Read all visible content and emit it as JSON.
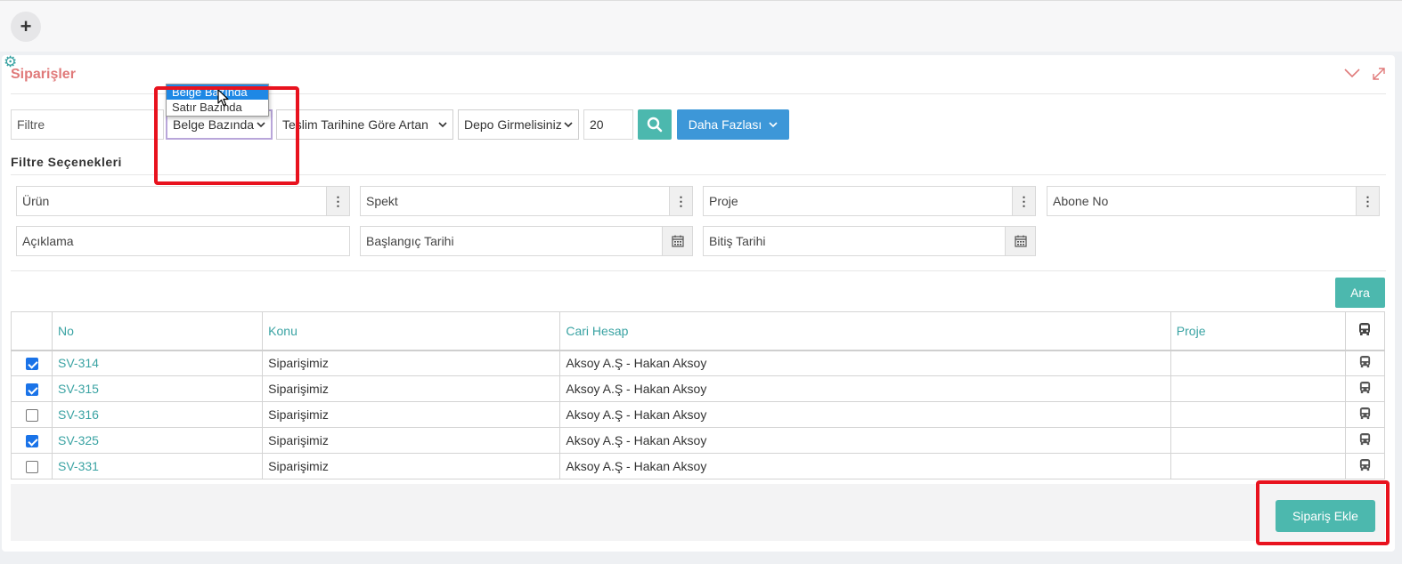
{
  "toolbar": {
    "add_label": "+"
  },
  "panel": {
    "title": "Siparişler"
  },
  "filters": {
    "filter_placeholder": "Filtre",
    "scope_select": "Belge Bazında",
    "sort_select": "Teslim Tarihine Göre Artan",
    "depot_select": "Depo Girmelisiniz",
    "page_size": "20",
    "more_label": "Daha Fazlası",
    "scope_options": [
      "Belge Bazında",
      "Satır Bazında"
    ]
  },
  "filter_options": {
    "title": "Filtre Seçenekleri",
    "fields": {
      "urun": "Ürün",
      "spekt": "Spekt",
      "proje": "Proje",
      "abone_no": "Abone No",
      "aciklama": "Açıklama",
      "baslangic": "Başlangıç Tarihi",
      "bitis": "Bitiş Tarihi"
    },
    "search_label": "Ara"
  },
  "table": {
    "headers": [
      "No",
      "Konu",
      "Cari Hesap",
      "Proje"
    ],
    "rows": [
      {
        "checked": true,
        "no": "SV-314",
        "konu": "Siparişimiz",
        "cari": "Aksoy A.Ş - Hakan Aksoy",
        "proje": ""
      },
      {
        "checked": true,
        "no": "SV-315",
        "konu": "Siparişimiz",
        "cari": "Aksoy A.Ş - Hakan Aksoy",
        "proje": ""
      },
      {
        "checked": false,
        "no": "SV-316",
        "konu": "Siparişimiz",
        "cari": "Aksoy A.Ş - Hakan Aksoy",
        "proje": ""
      },
      {
        "checked": true,
        "no": "SV-325",
        "konu": "Siparişimiz",
        "cari": "Aksoy A.Ş - Hakan Aksoy",
        "proje": ""
      },
      {
        "checked": false,
        "no": "SV-331",
        "konu": "Siparişimiz",
        "cari": "Aksoy A.Ş - Hakan Aksoy",
        "proje": ""
      }
    ]
  },
  "footer": {
    "add_order_label": "Sipariş Ekle"
  },
  "colors": {
    "teal": "#4cb8ae",
    "blue": "#3d97d8",
    "title_red": "#e07a7a",
    "highlight_red": "#e8121e"
  },
  "icons": [
    "plus-icon",
    "gear-icon",
    "chevron-down-icon",
    "expand-icon",
    "search-icon",
    "kebab-icon",
    "calendar-icon",
    "bus-icon",
    "cursor-icon"
  ]
}
